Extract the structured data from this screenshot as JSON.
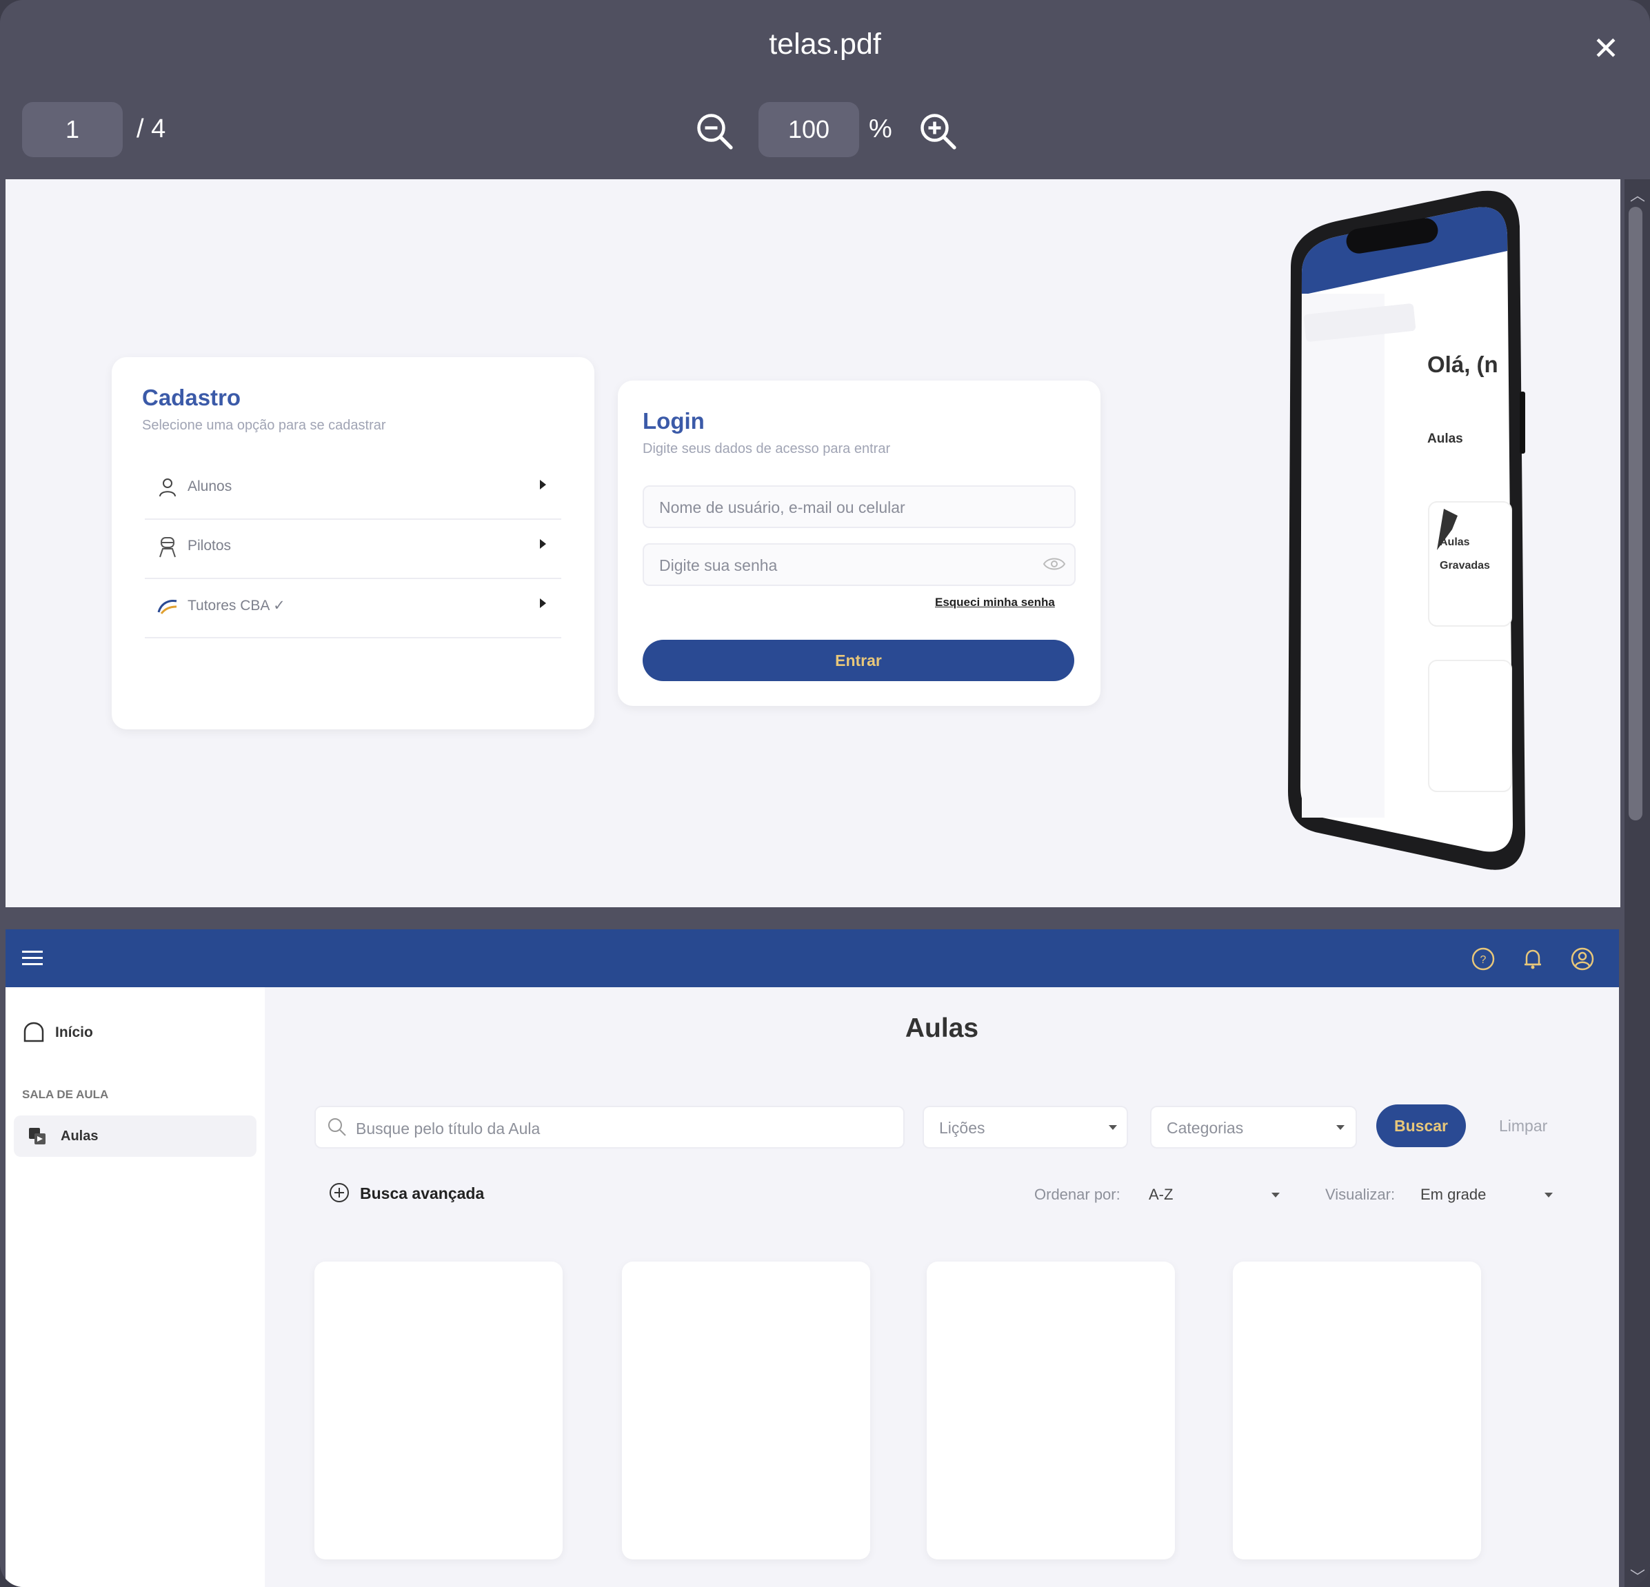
{
  "viewer": {
    "title": "telas.pdf",
    "current_page": "1",
    "page_total": "/  4",
    "zoom": "100",
    "zoom_unit": "%"
  },
  "page1": {
    "cadastro": {
      "title": "Cadastro",
      "subtitle": "Selecione uma opção para se cadastrar",
      "options": [
        {
          "label": "Alunos",
          "icon": "user-icon"
        },
        {
          "label": "Pilotos",
          "icon": "pilot-icon"
        },
        {
          "label": "Tutores CBA ✓",
          "icon": "cba-logo-icon"
        }
      ]
    },
    "login": {
      "title": "Login",
      "subtitle": "Digite seus dados de acesso para entrar",
      "user_placeholder": "Nome de usuário, e-mail ou celular",
      "password_placeholder": "Digite sua senha",
      "forgot": "Esqueci minha senha",
      "submit": "Entrar"
    },
    "phone": {
      "greeting": "Olá, (n",
      "section": "Aulas",
      "card_label_1": "Aulas",
      "card_label_2": "Gravadas"
    }
  },
  "page2": {
    "sidebar": {
      "home": "Início",
      "section": "SALA DE AULA",
      "active_item": "Aulas"
    },
    "main": {
      "title": "Aulas",
      "search_placeholder": "Busque pelo título da Aula",
      "lessons_select": "Lições",
      "categories_select": "Categorias",
      "search_button": "Buscar",
      "clear_button": "Limpar",
      "advanced_search": "Busca avançada",
      "order_label": "Ordenar por:",
      "order_value": "A-Z",
      "view_label": "Visualizar:",
      "view_value": "Em grade"
    }
  },
  "colors": {
    "brand_blue": "#284990",
    "button_text_gold": "#e8c77a",
    "title_blue": "#3b5aa8"
  }
}
